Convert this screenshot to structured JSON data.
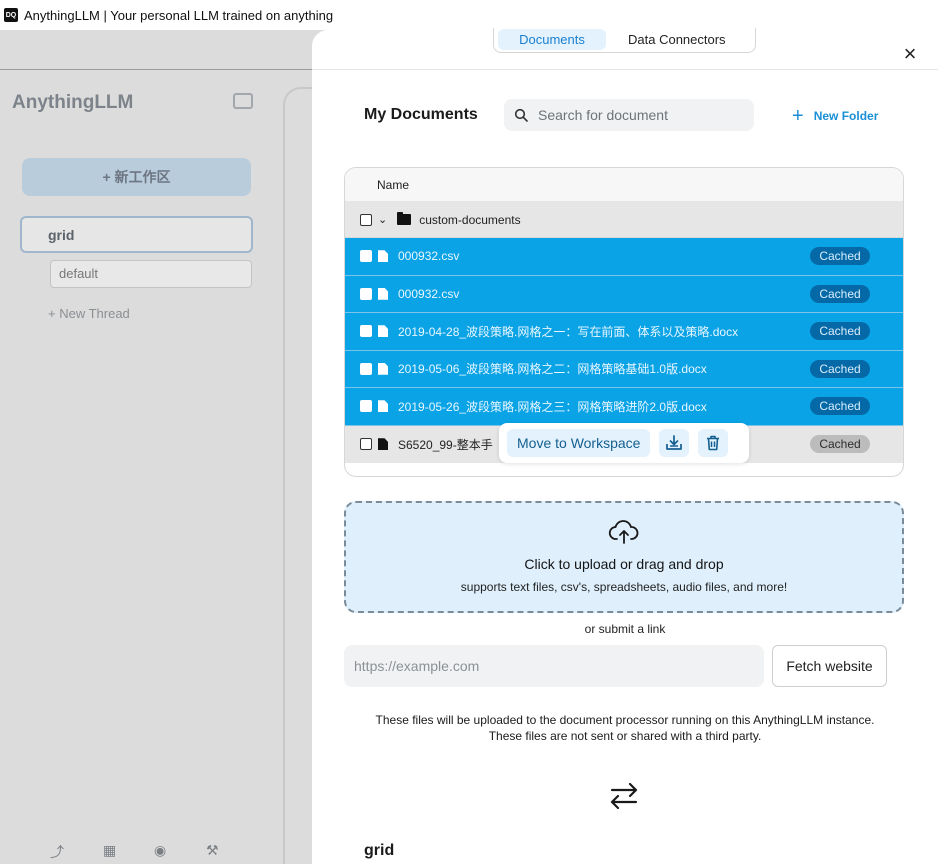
{
  "window": {
    "title": "AnythingLLM | Your personal LLM trained on anything",
    "logo": "DQ"
  },
  "background": {
    "brand": "AnythingLLM",
    "new_workspace": "+ 新工作区",
    "workspace": "grid",
    "thread": "default",
    "new_thread": "+    New Thread"
  },
  "modal": {
    "tabs": [
      "Documents",
      "Data Connectors"
    ],
    "close_icon": "×",
    "title": "My Documents",
    "search_placeholder": "Search for document",
    "new_folder": "New Folder",
    "table": {
      "column": "Name",
      "folder": "custom-documents",
      "files": [
        {
          "name": "000932.csv",
          "status": "Cached",
          "selected": true
        },
        {
          "name": "000932.csv",
          "status": "Cached",
          "selected": true
        },
        {
          "name": "2019-04-28_波段策略.网格之一：写在前面、体系以及策略.docx",
          "status": "Cached",
          "selected": true
        },
        {
          "name": "2019-05-06_波段策略.网格之二：网格策略基础1.0版.docx",
          "status": "Cached",
          "selected": true
        },
        {
          "name": "2019-05-26_波段策略.网格之三：网格策略进阶2.0版.docx",
          "status": "Cached",
          "selected": true
        },
        {
          "name": "S6520_99-整本手",
          "status": "Cached",
          "selected": false
        }
      ]
    },
    "actions": {
      "move": "Move to Workspace"
    },
    "upload": {
      "title": "Click to upload or drag and drop",
      "subtitle": "supports text files, csv's, spreadsheets, audio files, and more!",
      "or_link": "or submit a link",
      "url_placeholder": "https://example.com",
      "fetch": "Fetch website",
      "disclaimer_1": "These files will be uploaded to the document processor running on this AnythingLLM instance.",
      "disclaimer_2": "These files are not sent or shared with a third party."
    },
    "workspace_title": "grid"
  },
  "colors": {
    "accent": "#0aa3e6",
    "badge": "#0569a8",
    "tab_active_bg": "#e3f2fd"
  }
}
